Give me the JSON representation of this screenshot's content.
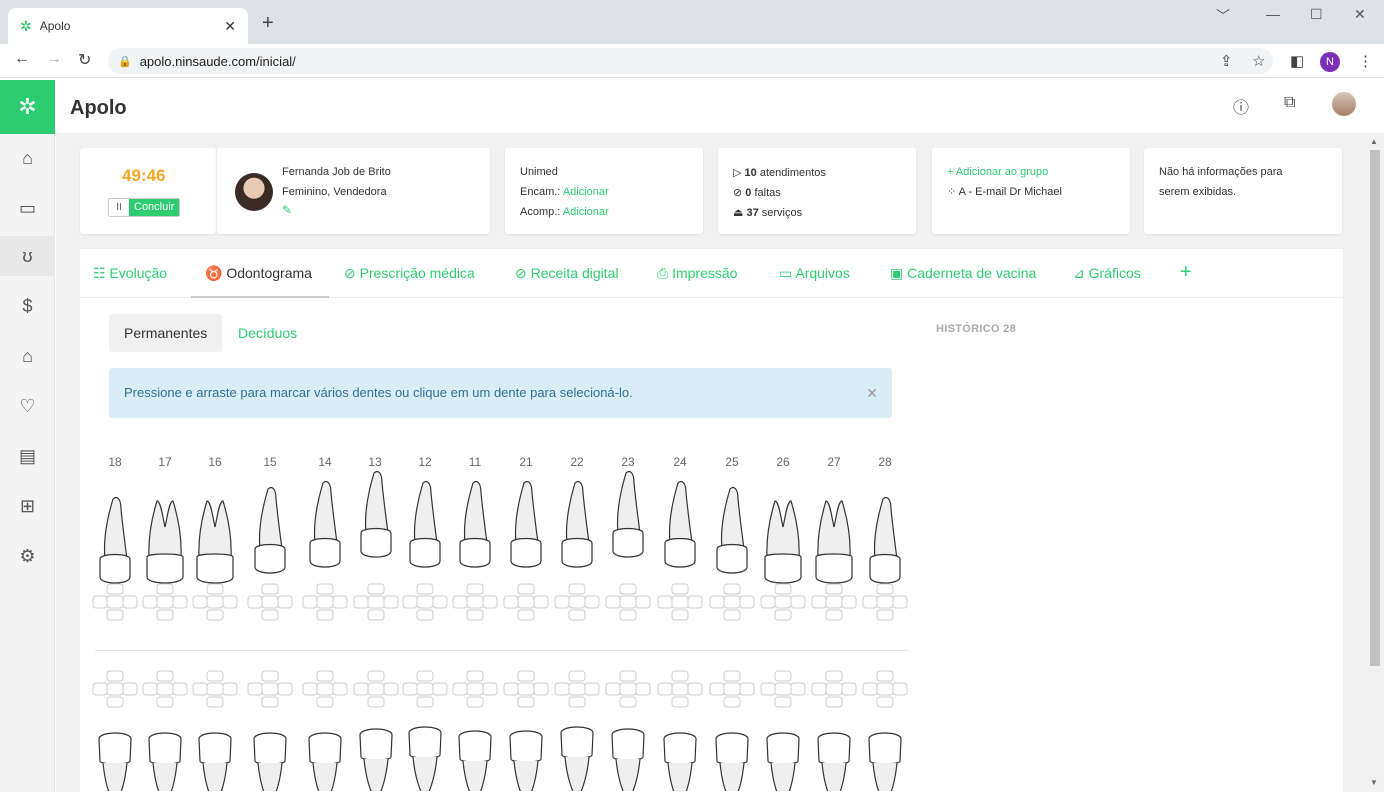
{
  "browser": {
    "tab_title": "Apolo",
    "url": "apolo.ninsaude.com/inicial/",
    "profile_initial": "N"
  },
  "app": {
    "title": "Apolo"
  },
  "session": {
    "timer": "49:46",
    "conclude_label": "Concluir"
  },
  "patient": {
    "name": "Fernanda Job de Brito",
    "details": "Feminino, Vendedora"
  },
  "insurance": {
    "name": "Unimed",
    "encam_label": "Encam.:",
    "encam_value": "Adicionar",
    "acomp_label": "Acomp.:",
    "acomp_value": "Adicionar"
  },
  "stats": {
    "appointments_count": "10",
    "appointments_label": "atendimentos",
    "absences_count": "0",
    "absences_label": "faltas",
    "services_count": "37",
    "services_label": "serviços"
  },
  "group": {
    "add_label": "+ Adicionar ao grupo",
    "group_name": "A - E-mail Dr Michael"
  },
  "notes": {
    "text_line1": "Não há informações para",
    "text_line2": "serem exibidas."
  },
  "tabs": [
    {
      "label": "Evolução"
    },
    {
      "label": "Odontograma"
    },
    {
      "label": "Prescrição médica"
    },
    {
      "label": "Receita digital"
    },
    {
      "label": "Impressão"
    },
    {
      "label": "Arquivos"
    },
    {
      "label": "Caderneta de vacina"
    },
    {
      "label": "Gráficos"
    }
  ],
  "subtabs": {
    "permanent": "Permanentes",
    "deciduous": "Decíduos"
  },
  "alert": {
    "text": "Pressione e arraste para marcar vários dentes ou clique em um dente para selecioná-lo."
  },
  "history": {
    "label": "HISTÓRICO 28"
  },
  "teeth_upper": [
    "18",
    "17",
    "16",
    "15",
    "14",
    "13",
    "12",
    "11",
    "21",
    "22",
    "23",
    "24",
    "25",
    "26",
    "27",
    "28"
  ]
}
